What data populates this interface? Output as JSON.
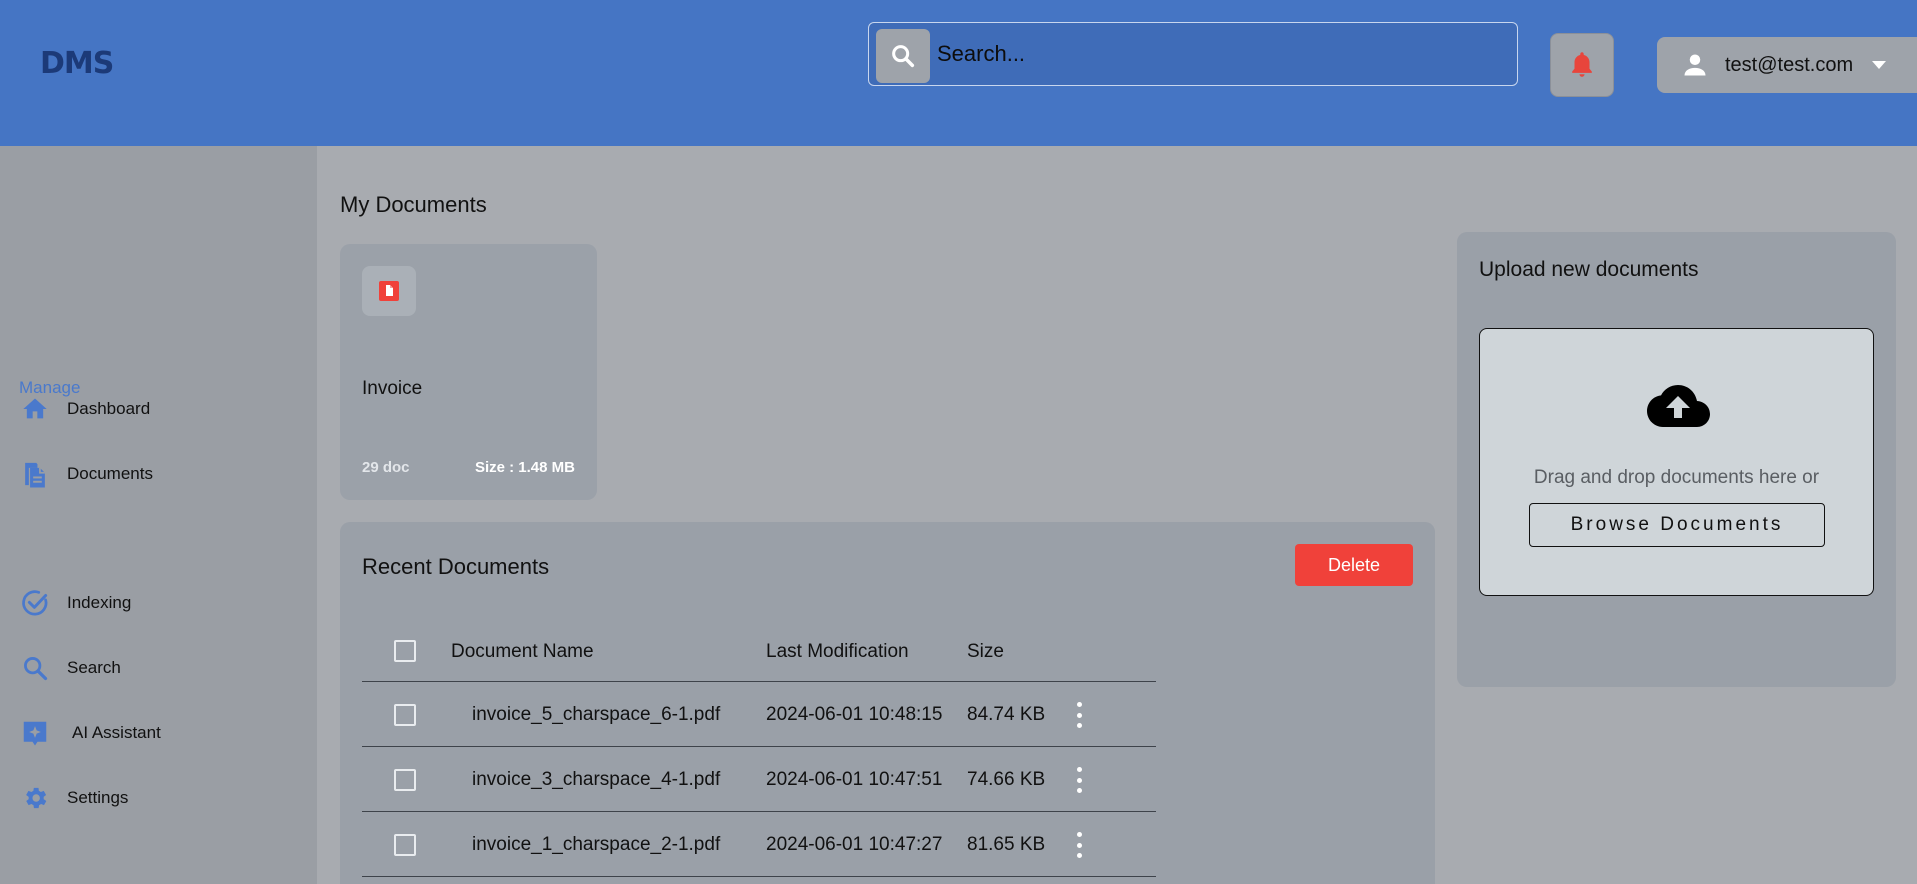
{
  "header": {
    "logo_text_left": "D",
    "logo_text_mid": "M",
    "logo_text_right": "S",
    "search": {
      "placeholder": "Search..."
    },
    "user": {
      "email": "test@test.com"
    }
  },
  "sidebar": {
    "items": [
      {
        "label": "Dashboard",
        "icon": "home-icon"
      },
      {
        "label": "Documents",
        "icon": "documents-icon"
      },
      {
        "label": "Indexing",
        "icon": "check-circle-icon"
      },
      {
        "label": "Search",
        "icon": "search-icon"
      },
      {
        "label": "AI Assistant",
        "icon": "ai-sparkle-icon"
      },
      {
        "label": "Settings",
        "icon": "gear-icon"
      }
    ],
    "section_label": "Manage"
  },
  "main": {
    "title": "My Documents",
    "folder": {
      "name": "Invoice",
      "count": "29 doc",
      "size": "Size : 1.48 MB"
    },
    "recent": {
      "title": "Recent Documents",
      "delete_label": "Delete",
      "columns": [
        "Document Name",
        "Last Modification",
        "Size"
      ],
      "rows": [
        {
          "name": "invoice_5_charspace_6-1.pdf",
          "modified": "2024-06-01 10:48:15",
          "size": "84.74 KB"
        },
        {
          "name": "invoice_3_charspace_4-1.pdf",
          "modified": "2024-06-01 10:47:51",
          "size": "74.66 KB"
        },
        {
          "name": "invoice_1_charspace_2-1.pdf",
          "modified": "2024-06-01 10:47:27",
          "size": "81.65 KB"
        }
      ]
    }
  },
  "upload": {
    "title": "Upload new documents",
    "drop_text": "Drag and drop documents here or",
    "browse_label": "Browse Documents"
  },
  "colors": {
    "topbar": "#4575c4",
    "accent": "#4a79cc",
    "delete": "#f0413a",
    "bell": "#e8453c"
  }
}
